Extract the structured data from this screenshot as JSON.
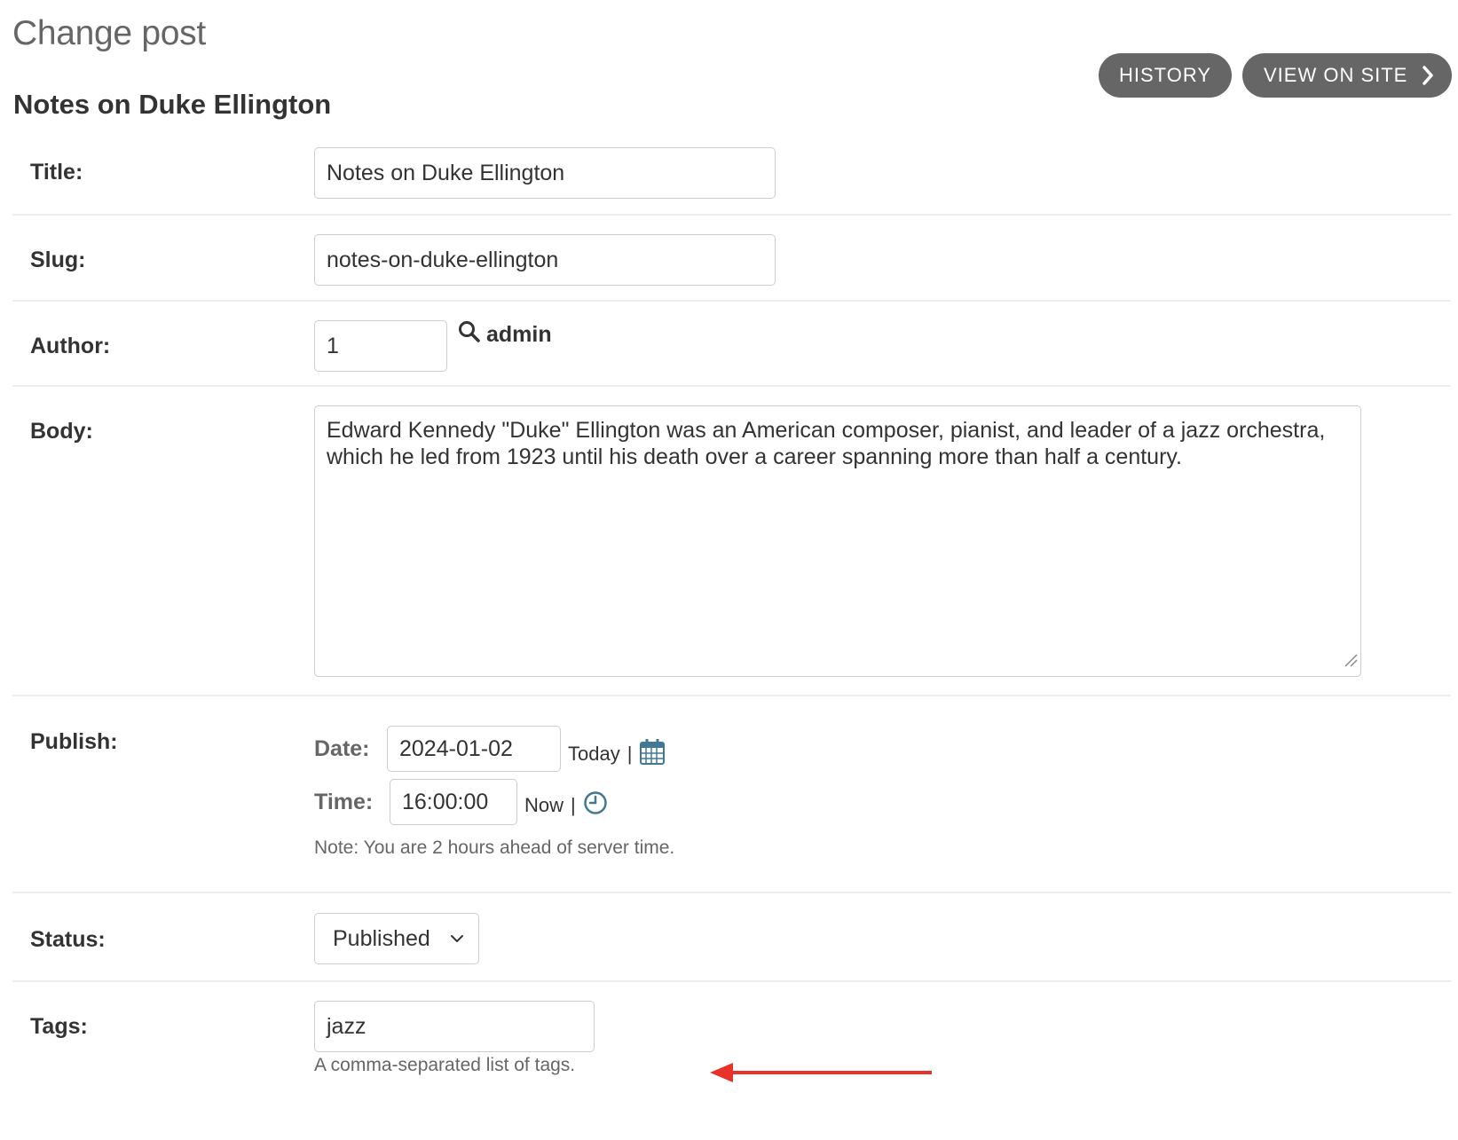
{
  "header": {
    "page_title": "Change post",
    "object_title": "Notes on Duke Ellington",
    "history_label": "HISTORY",
    "view_on_site_label": "VIEW ON SITE"
  },
  "form": {
    "title": {
      "label": "Title:",
      "value": "Notes on Duke Ellington"
    },
    "slug": {
      "label": "Slug:",
      "value": "notes-on-duke-ellington"
    },
    "author": {
      "label": "Author:",
      "value": "1",
      "lookup_text": "admin"
    },
    "body": {
      "label": "Body:",
      "value": "Edward Kennedy \"Duke\" Ellington was an American composer, pianist, and leader of a jazz orchestra, which he led from 1923 until his death over a career spanning more than half a century."
    },
    "publish": {
      "label": "Publish:",
      "date_label": "Date:",
      "date_value": "2024-01-02",
      "today_link": "Today",
      "time_label": "Time:",
      "time_value": "16:00:00",
      "now_link": "Now",
      "separator": "|",
      "timezone_note": "Note: You are 2 hours ahead of server time."
    },
    "status": {
      "label": "Status:",
      "selected": "Published"
    },
    "tags": {
      "label": "Tags:",
      "value": "jazz",
      "help_text": "A comma-separated list of tags."
    }
  },
  "colors": {
    "button_bg": "#666666",
    "calendar_icon": "#417893",
    "annotation_arrow": "#e8322a"
  },
  "icons": [
    "search-icon",
    "calendar-icon",
    "clock-icon",
    "chevron-right-icon",
    "chevron-down-icon",
    "resize-grip-icon",
    "annotation-arrow"
  ]
}
